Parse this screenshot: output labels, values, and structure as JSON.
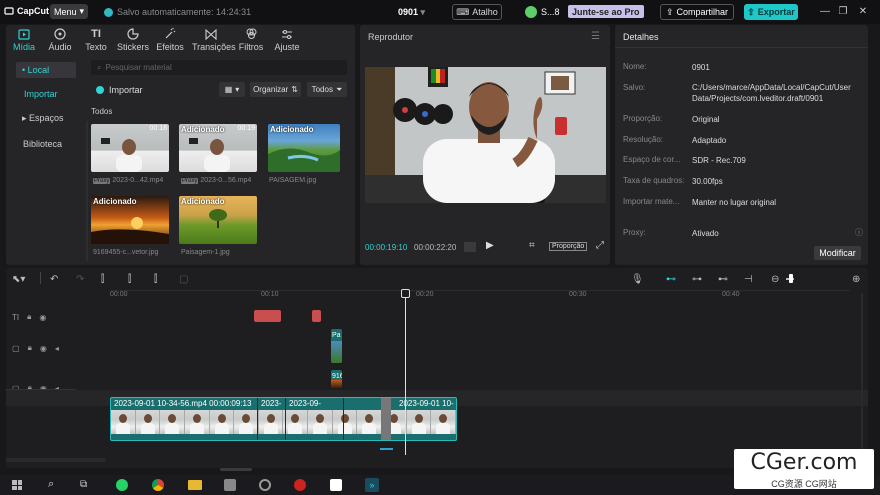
{
  "app": {
    "logo": "CapCut",
    "menu": "Menu",
    "autosave": "Salvo automaticamente: 14:24:31",
    "project": "0901",
    "shortcut": "Atalho",
    "user": "S...8",
    "pro": "Junte-se ao Pro",
    "share": "Compartilhar",
    "export": "Exportar"
  },
  "tool_tabs": [
    {
      "label": "Mídia",
      "icon": "media-icon"
    },
    {
      "label": "Áudio",
      "icon": "audio-icon"
    },
    {
      "label": "Texto",
      "icon": "text-icon"
    },
    {
      "label": "Stickers",
      "icon": "sticker-icon"
    },
    {
      "label": "Efeitos",
      "icon": "effects-icon"
    },
    {
      "label": "Transições",
      "icon": "transitions-icon"
    },
    {
      "label": "Filtros",
      "icon": "filters-icon"
    },
    {
      "label": "Ajuste",
      "icon": "adjust-icon"
    }
  ],
  "sidebar": [
    {
      "label": "• Local"
    },
    {
      "label": "Importar"
    },
    {
      "label": "▸ Espaços"
    },
    {
      "label": "Biblioteca"
    }
  ],
  "media": {
    "search_placeholder": "Pesquisar material",
    "import": "Importar",
    "organize": "Organizar",
    "all_filter": "Todos",
    "all_label": "Todos",
    "items": [
      {
        "badge": "",
        "duration": "00:18",
        "caption": "2023-0...42.mp4",
        "proxy": "Proxy"
      },
      {
        "badge": "Adicionado",
        "duration": "00:19",
        "caption": "2023-0...56.mp4",
        "proxy": "Proxy"
      },
      {
        "badge": "Adicionado",
        "duration": "",
        "caption": "PAISAGEM.jpg",
        "proxy": ""
      },
      {
        "badge": "Adicionado",
        "duration": "",
        "caption": "9169455-c...vetor.jpg",
        "proxy": ""
      },
      {
        "badge": "Adicionado",
        "duration": "",
        "caption": "Paisagem-1.jpg",
        "proxy": ""
      }
    ]
  },
  "player": {
    "title": "Reprodutor",
    "current_time": "00:00:19:10",
    "total_time": "00:00:22:20",
    "ratio": "Proporção"
  },
  "details": {
    "title": "Detalhes",
    "rows": [
      {
        "label": "Nome:",
        "value": "0901"
      },
      {
        "label": "Salvo:",
        "value": "C:/Users/marce/AppData/Local/CapCut/User",
        "value2": "Data/Projects/com.lveditor.draft/0901"
      },
      {
        "label": "Proporção:",
        "value": "Original"
      },
      {
        "label": "Resolução:",
        "value": "Adaptado"
      },
      {
        "label": "Espaço de cor...",
        "value": "SDR - Rec.709"
      },
      {
        "label": "Taxa de quadros:",
        "value": "30.00fps"
      },
      {
        "label": "Importar mate...",
        "value": "Manter no lugar original"
      },
      {
        "label": "Proxy:",
        "value": "Ativado"
      }
    ],
    "modify": "Modificar"
  },
  "timeline": {
    "ruler": [
      "00:00",
      "00:10",
      "00:20",
      "00:30",
      "00:40"
    ],
    "clips": [
      {
        "label": "2023-09-01 10-34-56.mp4  00:00:09:13"
      },
      {
        "label": "2023-"
      },
      {
        "label": "2023-09-"
      },
      {
        "label": "2023-09-01 10-"
      }
    ],
    "small_clip_1": "Pa",
    "small_clip_2": "916"
  },
  "watermark": {
    "big": "CGer.com",
    "small": "CG资源 CG网站"
  }
}
